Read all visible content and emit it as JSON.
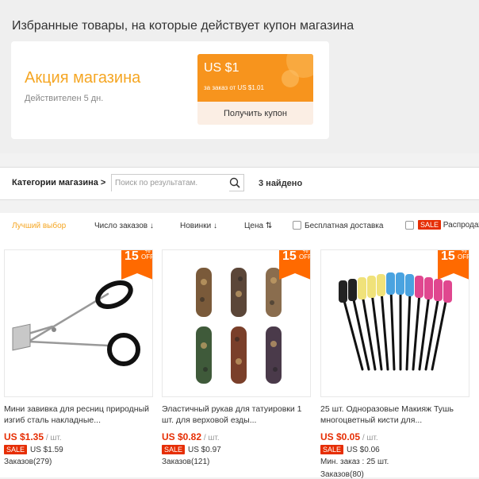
{
  "coupon_section": {
    "title": "Избранные товары, на которые действует купон магазина",
    "promo_title": "Акция магазина",
    "promo_validity": "Действителен 5 дн.",
    "coupon_amount": "US $1",
    "coupon_condition": "за заказ от US $1.01",
    "get_coupon_label": "Получить купон"
  },
  "filter_bar": {
    "categories_label": "Категории магазина >",
    "search_placeholder": "Поиск по результатам.",
    "found_text": "3 найдено"
  },
  "sort_bar": {
    "best_match": "Лучший выбор",
    "orders": "Число заказов ↓",
    "newest": "Новинки ↓",
    "price": "Цена ⇅",
    "free_shipping": "Бесплатная доставка",
    "sale_badge": "SALE",
    "sale_label": "Распродажа"
  },
  "colors": {
    "accent_orange": "#f5a623",
    "coupon_orange": "#f7941d",
    "sale_red": "#e62e04",
    "badge_orange": "#ff6a00"
  },
  "products": [
    {
      "discount": "15",
      "discount_pct": "%",
      "discount_off": "OFF",
      "title": "Мини завивка для ресниц природный изгиб сталь накладные...",
      "price": "US $1.35",
      "unit": " / шт.",
      "sale": "SALE",
      "old_price": "US $1.59",
      "orders": "Заказов(279)",
      "image_icon": "eyelash-curler"
    },
    {
      "discount": "15",
      "discount_pct": "%",
      "discount_off": "OFF",
      "title": "Эластичный рукав для татуировки 1 шт. для верховой езды...",
      "price": "US $0.82",
      "unit": " / шт.",
      "sale": "SALE",
      "old_price": "US $0.97",
      "orders": "Заказов(121)",
      "image_icon": "tattoo-sleeves"
    },
    {
      "discount": "15",
      "discount_pct": "%",
      "discount_off": "OFF",
      "title": "25 шт. Одноразовые Макияж Тушь многоцветный кисти для...",
      "price": "US $0.05",
      "unit": " / шт.",
      "sale": "SALE",
      "old_price": "US $0.06",
      "orders": "Мин. заказ : 25 шт.",
      "extra": "Заказов(80)",
      "image_icon": "mascara-brushes"
    }
  ]
}
